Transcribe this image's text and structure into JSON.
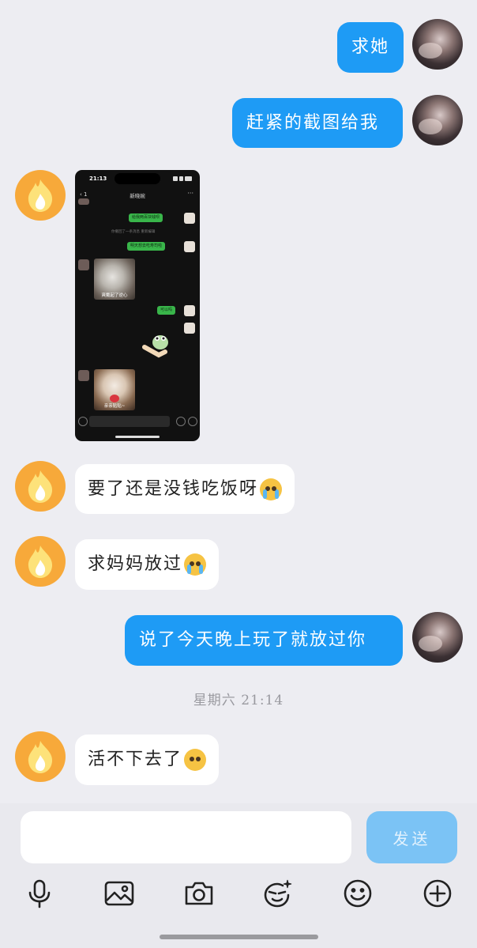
{
  "messages": [
    {
      "side": "me",
      "text": "求她"
    },
    {
      "side": "me",
      "text": "赶紧的截图给我"
    },
    {
      "side": "them",
      "type": "image"
    },
    {
      "side": "them",
      "text": "要了还是没钱吃饭呀",
      "emoji": "loudly-crying-emoji"
    },
    {
      "side": "them",
      "text": "求妈妈放过",
      "emoji": "loudly-crying-emoji"
    },
    {
      "side": "me",
      "text": "说了今天晚上玩了就放过你"
    },
    {
      "side": "them",
      "text": "活不下去了",
      "emoji": "pleading-face-emoji"
    }
  ],
  "timestamp": "星期六 21:14",
  "screenshot": {
    "status_time": "21:13",
    "chat_title": "新晓婉",
    "messages": [
      {
        "text": "给我两百块钱呗"
      },
      {
        "system": "你撤回了一条消息 重新编辑"
      },
      {
        "text": "明天想去吃寿司啦"
      },
      {
        "sticker_caption": "爽戴起了逆心"
      },
      {
        "text": "可以吗"
      },
      {
        "sticker_caption": "亲亲贴贴~"
      }
    ]
  },
  "composer": {
    "input_value": "",
    "send_label": "发送"
  },
  "toolbar": [
    "microphone-icon",
    "image-icon",
    "camera-icon",
    "sticker-icon",
    "emoji-icon",
    "plus-icon"
  ],
  "colors": {
    "background": "#ededf2",
    "my_bubble": "#1e9bf5",
    "their_bubble": "#ffffff",
    "send_button": "#7bc3f5",
    "their_avatar": "#f7a93a"
  }
}
